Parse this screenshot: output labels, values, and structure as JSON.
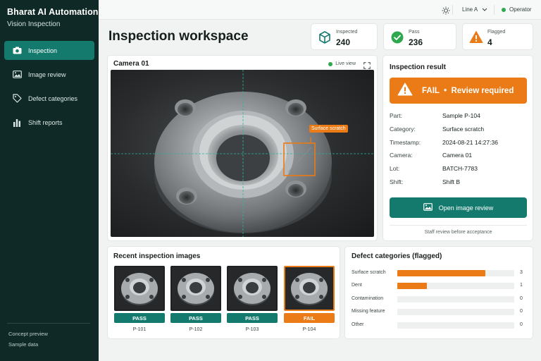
{
  "app": {
    "brand": "Bharat AI Automation",
    "subtitle": "Vision Inspection"
  },
  "sidebar": {
    "items": [
      {
        "label": "Inspection",
        "icon": "camera-icon",
        "active": true
      },
      {
        "label": "Image review",
        "icon": "image-icon",
        "active": false
      },
      {
        "label": "Defect categories",
        "icon": "tag-icon",
        "active": false
      },
      {
        "label": "Shift reports",
        "icon": "bar-chart-icon",
        "active": false
      }
    ],
    "footer": [
      "Concept preview",
      "Sample data"
    ]
  },
  "topbar": {
    "line": "Line A",
    "status": "Operator"
  },
  "page_title": "Inspection workspace",
  "stats": [
    {
      "label": "Inspected",
      "value": "240",
      "icon": "box-icon"
    },
    {
      "label": "Pass",
      "value": "236",
      "icon": "check-circle-icon"
    },
    {
      "label": "Flagged",
      "value": "4",
      "icon": "warning-icon"
    }
  ],
  "camera": {
    "title": "Camera 01",
    "live": "Live view",
    "defect_tag": "Surface scratch"
  },
  "result": {
    "title": "Inspection result",
    "banner": "FAIL  •  Review required",
    "fields": [
      {
        "key": "Part:",
        "value": "Sample P-104"
      },
      {
        "key": "Category:",
        "value": "Surface scratch"
      },
      {
        "key": "Timestamp:",
        "value": "2024-08-21 14:27:36"
      },
      {
        "key": "Camera:",
        "value": "Camera 01"
      },
      {
        "key": "Lot:",
        "value": "BATCH-7783"
      },
      {
        "key": "Shift:",
        "value": "Shift B"
      }
    ],
    "button": "Open image review",
    "note": "Staff review before acceptance"
  },
  "recent": {
    "title": "Recent inspection images",
    "items": [
      {
        "status": "PASS",
        "label": "P-101"
      },
      {
        "status": "PASS",
        "label": "P-102"
      },
      {
        "status": "PASS",
        "label": "P-103"
      },
      {
        "status": "FAIL",
        "label": "P-104"
      }
    ]
  },
  "defects": {
    "title": "Defect categories (flagged)",
    "rows": [
      {
        "name": "Surface scratch",
        "count": 3
      },
      {
        "name": "Dent",
        "count": 1
      },
      {
        "name": "Contamination",
        "count": 0
      },
      {
        "name": "Missing feature",
        "count": 0
      },
      {
        "name": "Other",
        "count": 0
      }
    ],
    "max": 4
  },
  "colors": {
    "sidebar": "#0f2a26",
    "accent": "#147a6e",
    "warning": "#ea7b17"
  }
}
